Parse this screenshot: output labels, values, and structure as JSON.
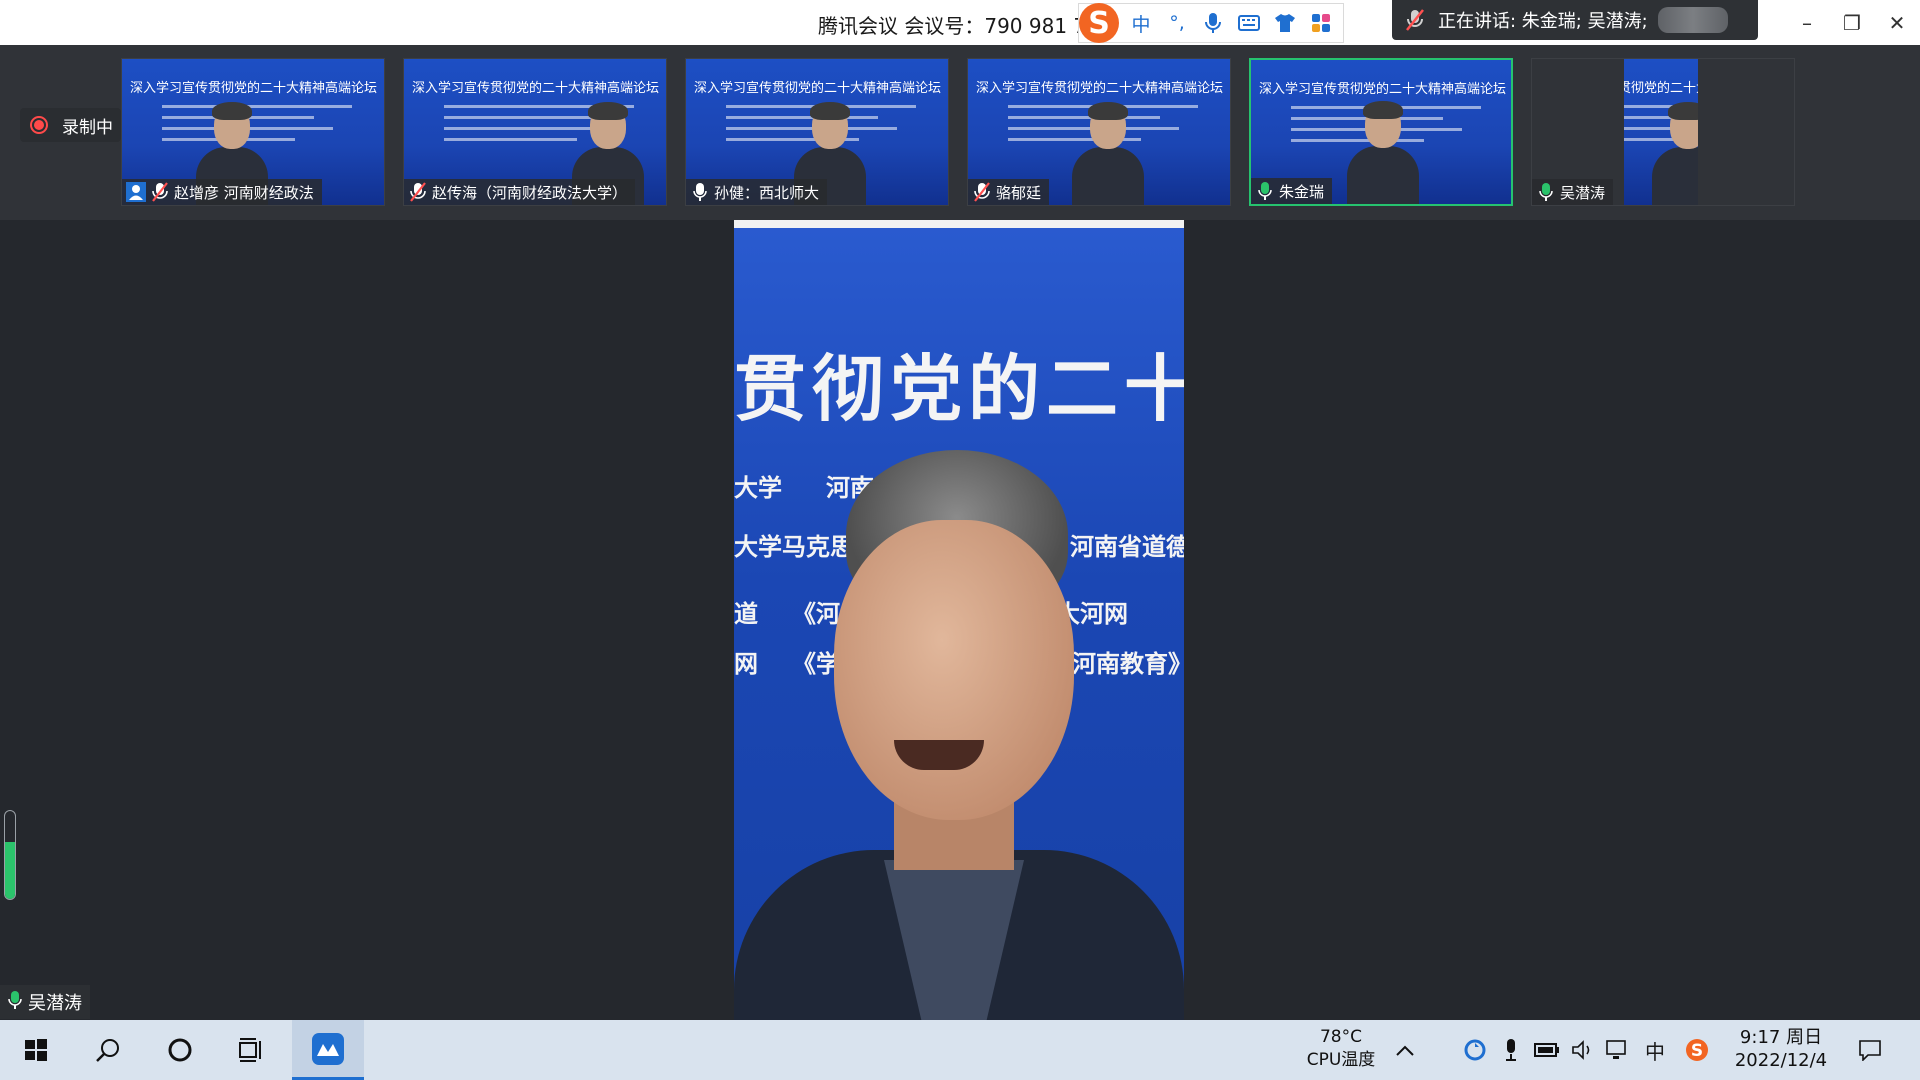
{
  "title_bar": {
    "meeting_title": "腾讯会议 会议号：790 981 7",
    "ime_icons": [
      "sogou-logo-icon",
      "chinese-mode",
      "punctuation-icon",
      "voice-input-icon",
      "keyboard-icon",
      "skin-icon",
      "toolbox-icon"
    ],
    "ime_mode_label": "中",
    "ime_punct_label": "°,",
    "speaking_text": "正在讲话: 朱金瑞; 吴潜涛;",
    "window_controls": {
      "minimize": "–",
      "restore": "❐",
      "close": "✕"
    }
  },
  "recording": {
    "label": "录制中"
  },
  "background_banner_text": "深入学习宣传贯彻党的二十大精神高端论坛",
  "participants": [
    {
      "name": "赵增彦 河南财经政法",
      "muted": true,
      "host": true,
      "active": false
    },
    {
      "name": "赵传海（河南财经政法大学）",
      "muted": true,
      "host": false,
      "active": false
    },
    {
      "name": "孙健：西北师大",
      "muted": false,
      "host": false,
      "active": false
    },
    {
      "name": "骆郁廷",
      "muted": true,
      "host": false,
      "active": false
    },
    {
      "name": "朱金瑞",
      "muted": false,
      "host": false,
      "active": true
    },
    {
      "name": "吴潜涛",
      "muted": false,
      "host": false,
      "active": false
    }
  ],
  "main_video": {
    "background_title": "贯彻党的二十大",
    "row1": [
      "大学",
      "河南"
    ],
    "row2": [
      "大学马克思",
      "河南省道德"
    ],
    "row3": [
      "道",
      "《河",
      "大河网"
    ],
    "row4": [
      "网",
      "《学",
      "《河南教育》"
    ]
  },
  "self_view": {
    "name": "吴潜涛",
    "mic_level": 0.65
  },
  "taskbar": {
    "cpu_temp": "78°C",
    "cpu_label": "CPU温度",
    "time": "9:17 周日",
    "date": "2022/12/4",
    "ime_indicator": "中",
    "active_app": "tencent-meeting"
  },
  "colors": {
    "accent": "#1f6fd0",
    "active_border": "#26c36f",
    "record_red": "#ff4a4a",
    "slide_blue": "#1d4fc4"
  }
}
